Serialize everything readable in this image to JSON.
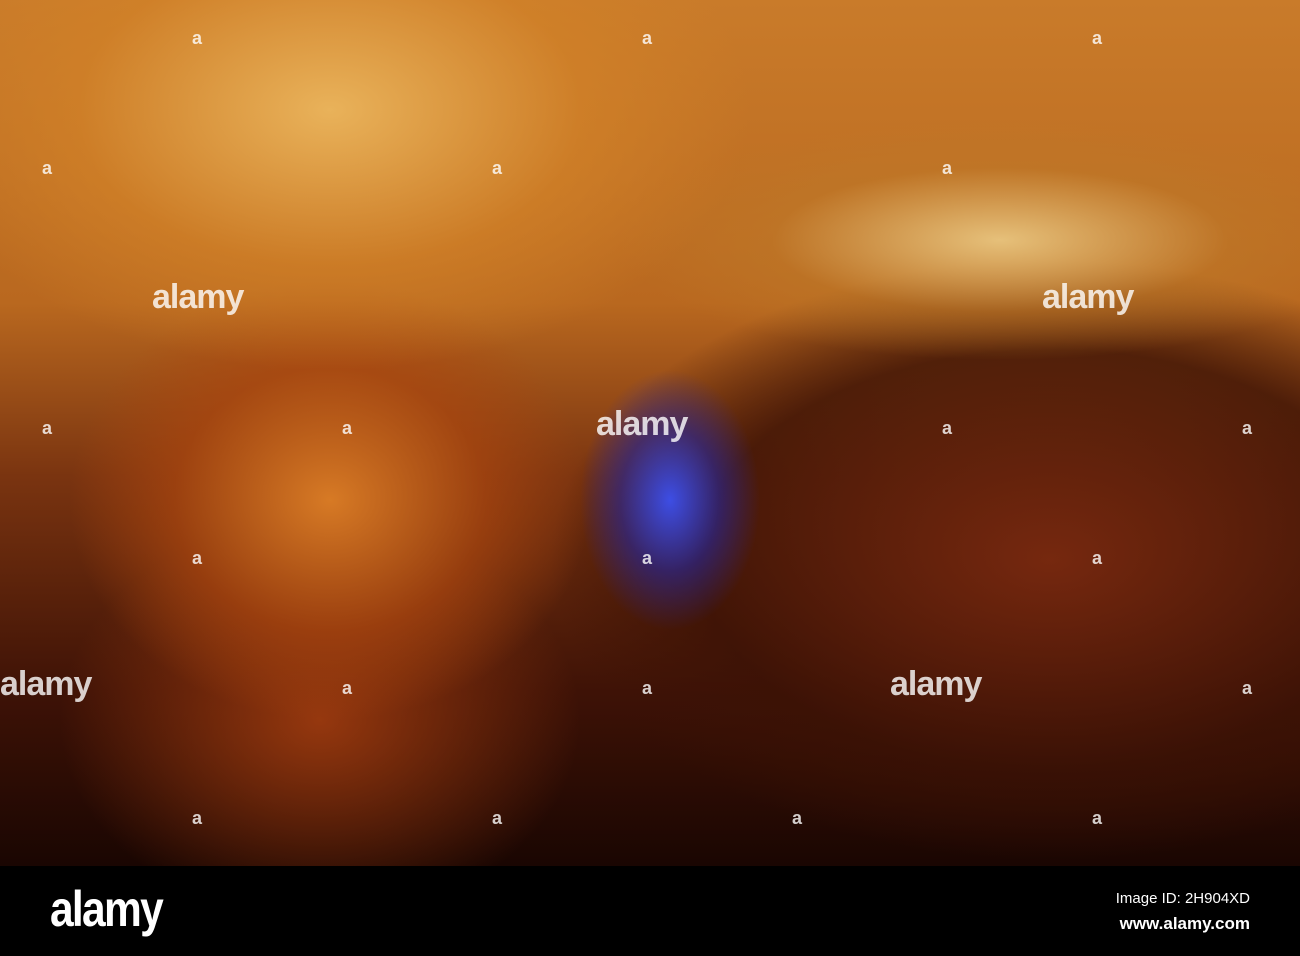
{
  "watermark": {
    "text": "alamy",
    "small": "a"
  },
  "footer": {
    "logo": "alamy",
    "image_id": "Image ID: 2H904XD",
    "website": "www.alamy.com"
  }
}
